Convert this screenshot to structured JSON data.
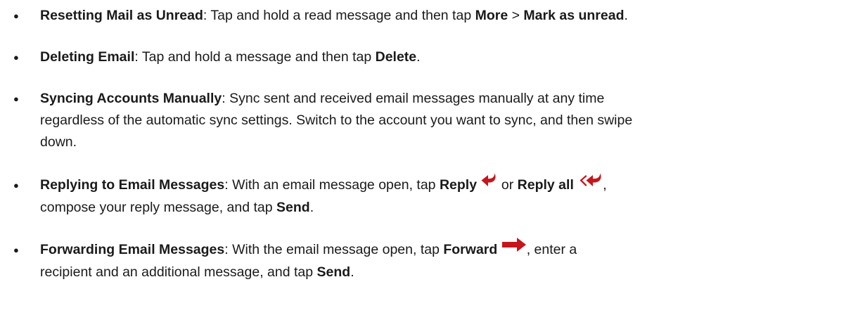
{
  "items": [
    {
      "title": "Resetting Mail as Unread",
      "sep": ": ",
      "t1": "Tap and hold a read message and then tap ",
      "b1": "More",
      "t2": " > ",
      "b2": "Mark as unread",
      "t3": "."
    },
    {
      "title": "Deleting Email",
      "sep": ": ",
      "t1": "Tap and hold a message and then tap ",
      "b1": "Delete",
      "t2": "."
    },
    {
      "title": "Syncing Accounts Manually",
      "sep": ": ",
      "line1": "Sync sent and received email messages manually at any time",
      "line2": "regardless of the automatic sync settings. Switch to the account you want to sync, and then swipe",
      "line3": "down."
    },
    {
      "title": "Replying to Email Messages",
      "sep": ": ",
      "t1": "With an email message open, tap ",
      "b1": "Reply",
      "t2": " or ",
      "b2": "Reply all",
      "t3": ",",
      "line2": "compose your reply message, and tap ",
      "b3": "Send",
      "t4": "."
    },
    {
      "title": "Forwarding Email Messages",
      "sep": ": ",
      "t1": "With the email message open, tap ",
      "b1": "Forward",
      "t2": ", enter a",
      "line2": "recipient and an additional message, and tap ",
      "b2": "Send",
      "t3": "."
    }
  ],
  "bullet": "●",
  "icons": {
    "reply": "reply-arrow-icon",
    "reply_all": "reply-all-arrow-icon",
    "forward": "forward-arrow-icon",
    "color": "#c4161c"
  }
}
